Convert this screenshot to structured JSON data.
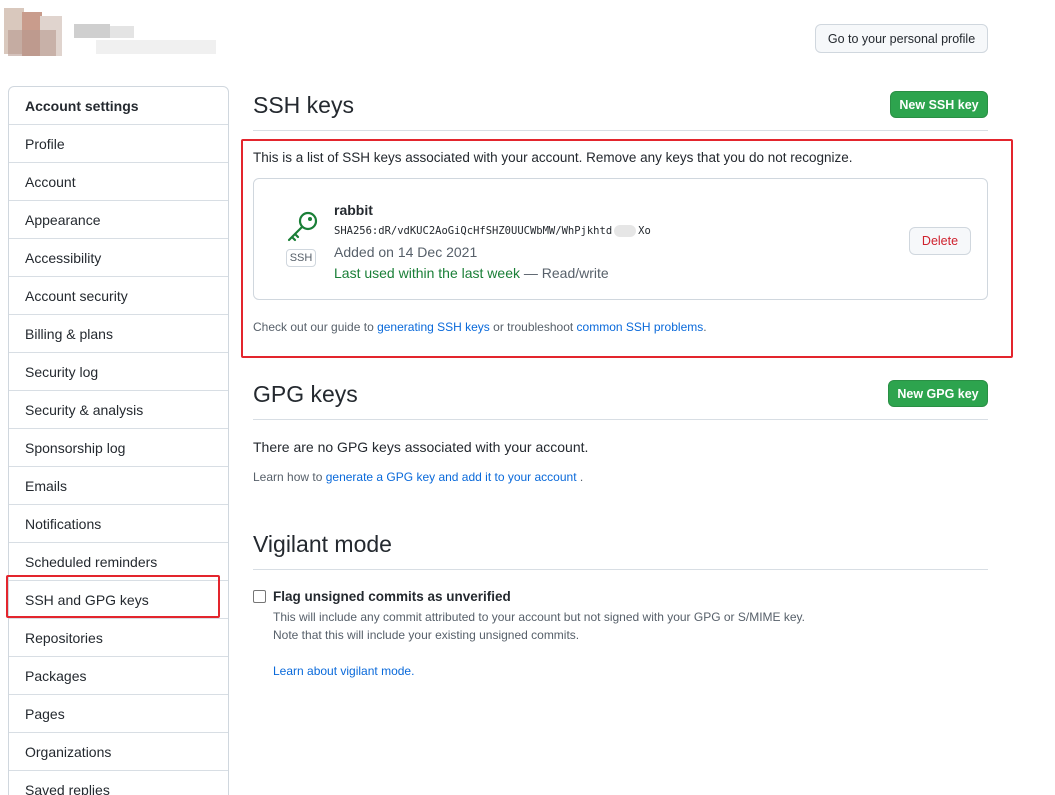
{
  "header": {
    "profile_button": "Go to your personal profile"
  },
  "sidebar": {
    "header": "Account settings",
    "items": [
      {
        "label": "Profile"
      },
      {
        "label": "Account"
      },
      {
        "label": "Appearance"
      },
      {
        "label": "Accessibility"
      },
      {
        "label": "Account security"
      },
      {
        "label": "Billing & plans"
      },
      {
        "label": "Security log"
      },
      {
        "label": "Security & analysis"
      },
      {
        "label": "Sponsorship log"
      },
      {
        "label": "Emails"
      },
      {
        "label": "Notifications"
      },
      {
        "label": "Scheduled reminders"
      },
      {
        "label": "SSH and GPG keys"
      },
      {
        "label": "Repositories"
      },
      {
        "label": "Packages"
      },
      {
        "label": "Pages"
      },
      {
        "label": "Organizations"
      },
      {
        "label": "Saved replies"
      }
    ]
  },
  "ssh": {
    "title": "SSH keys",
    "new_button": "New SSH key",
    "intro": "This is a list of SSH keys associated with your account. Remove any keys that you do not recognize.",
    "key": {
      "badge": "SSH",
      "name": "rabbit",
      "fingerprint_start": "SHA256:dR/vdKUC2AoGiQcHfSHZ0UUCWbMW/WhPjkhtd",
      "fingerprint_end": "Xo",
      "added": "Added on 14 Dec 2021",
      "last_used": "Last used within the last week",
      "access": " — Read/write",
      "delete_button": "Delete"
    },
    "guide_prefix": "Check out our guide to ",
    "guide_link1": "generating SSH keys",
    "guide_middle": " or troubleshoot ",
    "guide_link2": "common SSH problems",
    "guide_suffix": "."
  },
  "gpg": {
    "title": "GPG keys",
    "new_button": "New GPG key",
    "empty": "There are no GPG keys associated with your account.",
    "learn_prefix": "Learn how to ",
    "learn_link": "generate a GPG key and add it to your account",
    "learn_suffix": " ."
  },
  "vigilant": {
    "title": "Vigilant mode",
    "checkbox_label": "Flag unsigned commits as unverified",
    "desc1": "This will include any commit attributed to your account but not signed with your GPG or S/MIME key.",
    "desc2": "Note that this will include your existing unsigned commits.",
    "learn_link": "Learn about vigilant mode."
  },
  "colors": {
    "primary_green": "#2da44e",
    "link_blue": "#0969da",
    "danger_red": "#cf222e",
    "annotation_red": "#e3252d"
  }
}
